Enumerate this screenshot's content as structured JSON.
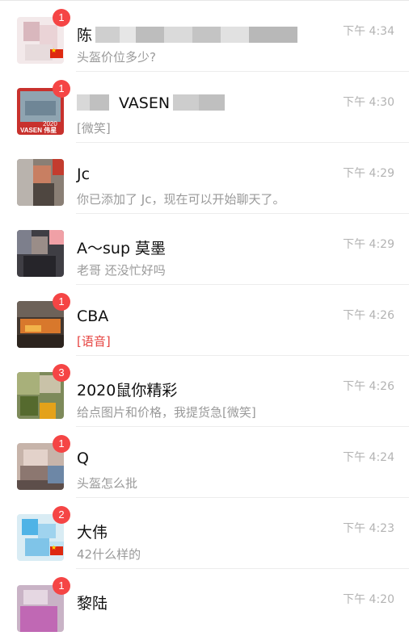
{
  "chats": [
    {
      "name": "陈",
      "preview": "头盔价位多少?",
      "time": "下午 4:34",
      "badge": "1",
      "flag": true
    },
    {
      "name": "VASEN",
      "preview": "[微笑]",
      "time": "下午 4:30",
      "badge": "1",
      "avatar_text": "2020",
      "avatar_brand": "VASEN 伟星"
    },
    {
      "name": "Jc",
      "preview": "你已添加了 Jc，现在可以开始聊天了。",
      "time": "下午 4:29",
      "badge": ""
    },
    {
      "name": "A～sup 莫墨",
      "preview": "老哥 还没忙好吗",
      "time": "下午 4:29",
      "badge": ""
    },
    {
      "name": "CBA",
      "preview": "[语音]",
      "time": "下午 4:26",
      "badge": "1",
      "voice": true
    },
    {
      "name": "2020鼠你精彩",
      "preview": "给点图片和价格，我提货急[微笑]",
      "time": "下午 4:26",
      "badge": "3"
    },
    {
      "name": "Q",
      "preview": "头盔怎么批",
      "time": "下午 4:24",
      "badge": "1"
    },
    {
      "name": "大伟",
      "preview": "42什么样的",
      "time": "下午 4:23",
      "badge": "2",
      "flag": true
    },
    {
      "name": "黎陆",
      "preview": "",
      "time": "下午 4:20",
      "badge": "1"
    }
  ],
  "colors": {
    "badge": "#f54545",
    "voice": "#e64340",
    "preview": "#9a9a9a",
    "time": "#b3b3b3"
  }
}
